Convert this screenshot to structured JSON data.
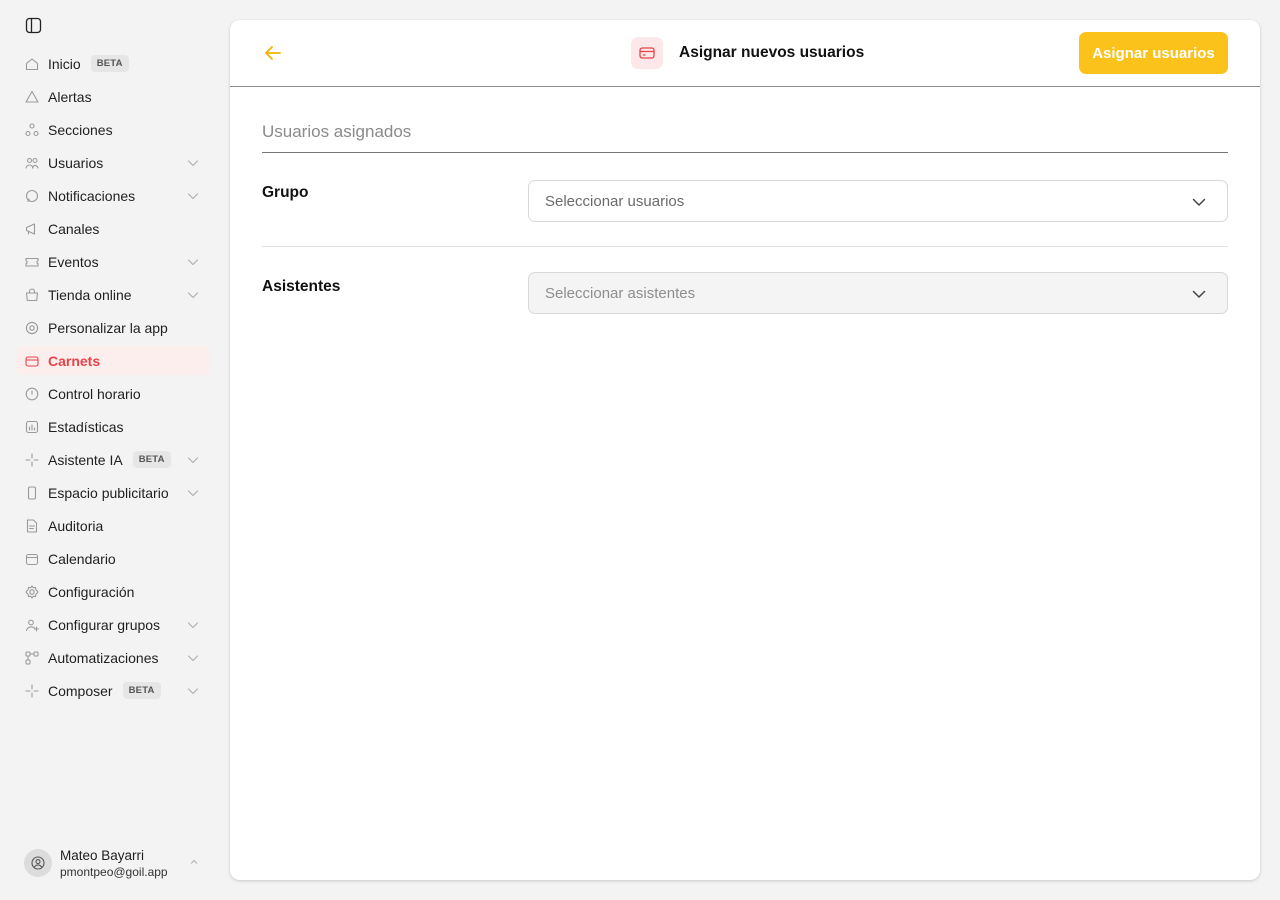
{
  "sidebar": {
    "items": [
      {
        "label": "Inicio",
        "badge": "BETA",
        "icon": "home-icon",
        "chevron": false
      },
      {
        "label": "Alertas",
        "badge": "",
        "icon": "alert-icon",
        "chevron": false
      },
      {
        "label": "Secciones",
        "badge": "",
        "icon": "sections-icon",
        "chevron": false
      },
      {
        "label": "Usuarios",
        "badge": "",
        "icon": "users-icon",
        "chevron": true
      },
      {
        "label": "Notificaciones",
        "badge": "",
        "icon": "chat-icon",
        "chevron": true
      },
      {
        "label": "Canales",
        "badge": "",
        "icon": "megaphone-icon",
        "chevron": false
      },
      {
        "label": "Eventos",
        "badge": "",
        "icon": "ticket-icon",
        "chevron": true
      },
      {
        "label": "Tienda online",
        "badge": "",
        "icon": "shop-icon",
        "chevron": true
      },
      {
        "label": "Personalizar la app",
        "badge": "",
        "icon": "cog-icon",
        "chevron": false
      },
      {
        "label": "Carnets",
        "badge": "",
        "icon": "card-icon",
        "chevron": false,
        "active": true
      },
      {
        "label": "Control horario",
        "badge": "",
        "icon": "clock-icon",
        "chevron": false
      },
      {
        "label": "Estadísticas",
        "badge": "",
        "icon": "chart-icon",
        "chevron": false
      },
      {
        "label": "Asistente IA",
        "badge": "BETA",
        "icon": "sparkle-icon",
        "chevron": true
      },
      {
        "label": "Espacio publicitario",
        "badge": "",
        "icon": "phone-icon",
        "chevron": true
      },
      {
        "label": "Auditoria",
        "badge": "",
        "icon": "document-icon",
        "chevron": false
      },
      {
        "label": "Calendario",
        "badge": "",
        "icon": "calendar-icon",
        "chevron": false
      },
      {
        "label": "Configuración",
        "badge": "",
        "icon": "settings-icon",
        "chevron": false
      },
      {
        "label": "Configurar grupos",
        "badge": "",
        "icon": "group-icon",
        "chevron": true
      },
      {
        "label": "Automatizaciones",
        "badge": "",
        "icon": "flow-icon",
        "chevron": true
      },
      {
        "label": "Composer",
        "badge": "BETA",
        "icon": "sparkle-icon",
        "chevron": true
      }
    ],
    "user": {
      "name": "Mateo Bayarri",
      "email": "pmontpeo@goil.app"
    }
  },
  "header": {
    "title": "Asignar nuevos usuarios",
    "assign_label": "Asignar usuarios"
  },
  "main": {
    "section_title": "Usuarios asignados",
    "group_label": "Grupo",
    "group_placeholder": "Seleccionar usuarios",
    "attendees_label": "Asistentes",
    "attendees_placeholder": "Seleccionar asistentes"
  },
  "colors": {
    "accent": "#fbc21b",
    "active": "#e8434a",
    "active_bg": "#fdeeee"
  }
}
